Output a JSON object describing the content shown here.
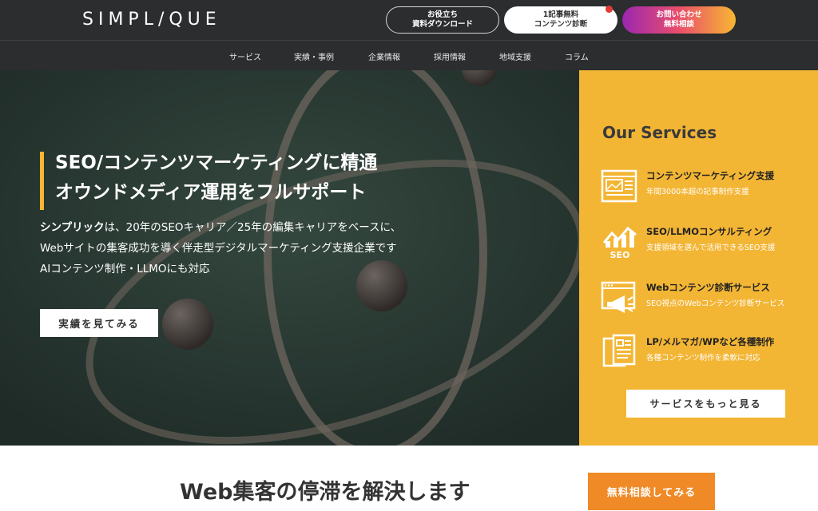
{
  "header": {
    "logo": "SIMPL/QUE",
    "download": {
      "line1": "お役立ち",
      "line2": "資料ダウンロード"
    },
    "diagnosis": {
      "line1": "1記事無料",
      "line2": "コンテンツ診断"
    },
    "contact": {
      "line1": "お問い合わせ",
      "line2": "無料相談"
    }
  },
  "nav": {
    "items": [
      "サービス",
      "実績・事例",
      "企業情報",
      "採用情報",
      "地域支援",
      "コラム"
    ]
  },
  "hero": {
    "title_line1": "SEO/コンテンツマーケティングに精通",
    "title_line2": "オウンドメディア運用をフルサポート",
    "desc_brand": "シンプリック",
    "desc_line1_rest": "は、20年のSEOキャリア／25年の編集キャリアをベースに、",
    "desc_line2": "Webサイトの集客成功を導く伴走型デジタルマーケティング支援企業です",
    "desc_line3": "AIコンテンツ制作・LLMOにも対応",
    "button": "実績を見てみる"
  },
  "services": {
    "title": "Our Services",
    "items": [
      {
        "name": "コンテンツマーケティング支援",
        "sub": "年間3000本超の記事制作支援",
        "icon": "article-layout-icon"
      },
      {
        "name": "SEO/LLMOコンサルティング",
        "sub": "支援領域を選んで活用できるSEO支援",
        "icon": "seo-chart-icon",
        "icon_text": "SEO"
      },
      {
        "name": "Webコンテンツ診断サービス",
        "sub": "SEO視点のWebコンテンツ診断サービス",
        "icon": "web-megaphone-icon"
      },
      {
        "name": "LP/メルマガ/WPなど各種制作",
        "sub": "各種コンテンツ制作を柔軟に対応",
        "icon": "documents-icon"
      }
    ],
    "button": "サービスをもっと見る"
  },
  "bottom": {
    "title": "Web集客の停滞を解決します",
    "button": "無料相談してみる"
  },
  "colors": {
    "header_bg": "#2b2d2e",
    "hero_bg": "#2a3a35",
    "accent_yellow": "#f3b534",
    "consult_orange": "#ef8a27",
    "notice_red": "#e53935"
  }
}
